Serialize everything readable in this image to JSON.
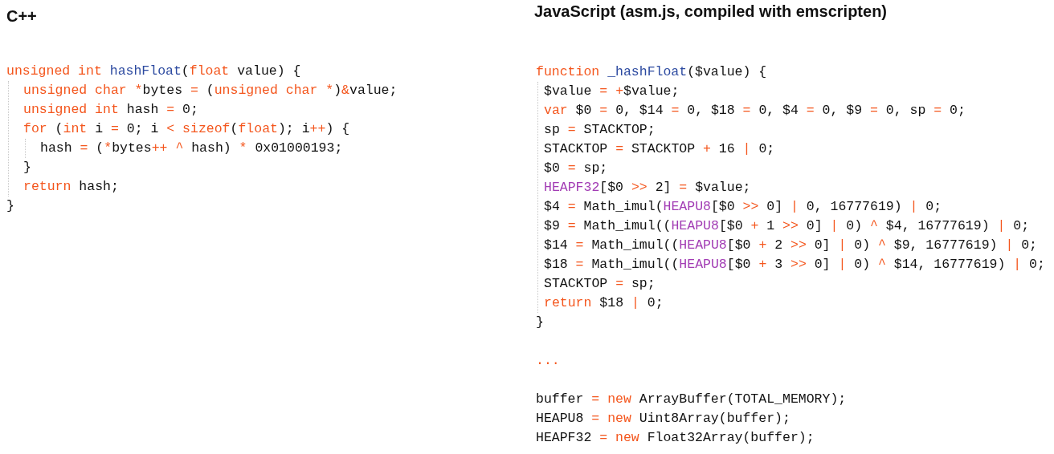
{
  "panels": [
    {
      "title": "C++",
      "blocks": [
        {
          "lines": [
            {
              "tokens": [
                {
                  "text": "unsigned int ",
                  "kind": "keyword"
                },
                {
                  "text": "hashFloat",
                  "kind": "function"
                },
                {
                  "text": "(",
                  "kind": "plain"
                },
                {
                  "text": "float",
                  "kind": "keyword"
                },
                {
                  "text": " value) {",
                  "kind": "plain"
                }
              ],
              "children": [
                {
                  "tokens": [
                    {
                      "text": "unsigned char *",
                      "kind": "keyword"
                    },
                    {
                      "text": "bytes ",
                      "kind": "plain"
                    },
                    {
                      "text": "=",
                      "kind": "keyword"
                    },
                    {
                      "text": " (",
                      "kind": "plain"
                    },
                    {
                      "text": "unsigned char *",
                      "kind": "keyword"
                    },
                    {
                      "text": ")",
                      "kind": "plain"
                    },
                    {
                      "text": "&",
                      "kind": "keyword"
                    },
                    {
                      "text": "value;",
                      "kind": "plain"
                    }
                  ]
                },
                {
                  "tokens": [
                    {
                      "text": "unsigned int",
                      "kind": "keyword"
                    },
                    {
                      "text": " hash ",
                      "kind": "plain"
                    },
                    {
                      "text": "=",
                      "kind": "keyword"
                    },
                    {
                      "text": " 0;",
                      "kind": "plain"
                    }
                  ]
                },
                {
                  "tokens": [
                    {
                      "text": "for",
                      "kind": "keyword"
                    },
                    {
                      "text": " (",
                      "kind": "plain"
                    },
                    {
                      "text": "int",
                      "kind": "keyword"
                    },
                    {
                      "text": " i ",
                      "kind": "plain"
                    },
                    {
                      "text": "=",
                      "kind": "keyword"
                    },
                    {
                      "text": " 0; i ",
                      "kind": "plain"
                    },
                    {
                      "text": "< ",
                      "kind": "keyword"
                    },
                    {
                      "text": "sizeof",
                      "kind": "keyword"
                    },
                    {
                      "text": "(",
                      "kind": "plain"
                    },
                    {
                      "text": "float",
                      "kind": "keyword"
                    },
                    {
                      "text": "); i",
                      "kind": "plain"
                    },
                    {
                      "text": "++",
                      "kind": "keyword"
                    },
                    {
                      "text": ") {",
                      "kind": "plain"
                    }
                  ],
                  "children": [
                    {
                      "tokens": [
                        {
                          "text": "hash ",
                          "kind": "plain"
                        },
                        {
                          "text": "=",
                          "kind": "keyword"
                        },
                        {
                          "text": " (",
                          "kind": "plain"
                        },
                        {
                          "text": "*",
                          "kind": "keyword"
                        },
                        {
                          "text": "bytes",
                          "kind": "plain"
                        },
                        {
                          "text": "++ ",
                          "kind": "keyword"
                        },
                        {
                          "text": "^",
                          "kind": "keyword"
                        },
                        {
                          "text": " hash) ",
                          "kind": "plain"
                        },
                        {
                          "text": "*",
                          "kind": "keyword"
                        },
                        {
                          "text": " 0x01000193;",
                          "kind": "plain"
                        }
                      ]
                    }
                  ]
                },
                {
                  "tokens": [
                    {
                      "text": "}",
                      "kind": "plain"
                    }
                  ]
                },
                {
                  "tokens": [
                    {
                      "text": "return",
                      "kind": "keyword"
                    },
                    {
                      "text": " hash;",
                      "kind": "plain"
                    }
                  ]
                }
              ]
            },
            {
              "tokens": [
                {
                  "text": "}",
                  "kind": "plain"
                }
              ]
            }
          ]
        }
      ]
    },
    {
      "title": "JavaScript (asm.js, compiled with emscripten)",
      "blocks": [
        {
          "lines": [
            {
              "tokens": [
                {
                  "text": "function ",
                  "kind": "keyword"
                },
                {
                  "text": "_hashFloat",
                  "kind": "function"
                },
                {
                  "text": "($value) {",
                  "kind": "plain"
                }
              ],
              "children": [
                {
                  "tokens": [
                    {
                      "text": "$value ",
                      "kind": "plain"
                    },
                    {
                      "text": "= ",
                      "kind": "keyword"
                    },
                    {
                      "text": "+",
                      "kind": "keyword"
                    },
                    {
                      "text": "$value;",
                      "kind": "plain"
                    }
                  ]
                },
                {
                  "tokens": [
                    {
                      "text": "var",
                      "kind": "keyword"
                    },
                    {
                      "text": " $0 ",
                      "kind": "plain"
                    },
                    {
                      "text": "=",
                      "kind": "keyword"
                    },
                    {
                      "text": " 0, $14 ",
                      "kind": "plain"
                    },
                    {
                      "text": "=",
                      "kind": "keyword"
                    },
                    {
                      "text": " 0, $18 ",
                      "kind": "plain"
                    },
                    {
                      "text": "=",
                      "kind": "keyword"
                    },
                    {
                      "text": " 0, $4 ",
                      "kind": "plain"
                    },
                    {
                      "text": "=",
                      "kind": "keyword"
                    },
                    {
                      "text": " 0, $9 ",
                      "kind": "plain"
                    },
                    {
                      "text": "=",
                      "kind": "keyword"
                    },
                    {
                      "text": " 0, sp ",
                      "kind": "plain"
                    },
                    {
                      "text": "=",
                      "kind": "keyword"
                    },
                    {
                      "text": " 0;",
                      "kind": "plain"
                    }
                  ]
                },
                {
                  "tokens": [
                    {
                      "text": "sp ",
                      "kind": "plain"
                    },
                    {
                      "text": "=",
                      "kind": "keyword"
                    },
                    {
                      "text": " STACKTOP;",
                      "kind": "plain"
                    }
                  ]
                },
                {
                  "tokens": [
                    {
                      "text": "STACKTOP ",
                      "kind": "plain"
                    },
                    {
                      "text": "=",
                      "kind": "keyword"
                    },
                    {
                      "text": " STACKTOP ",
                      "kind": "plain"
                    },
                    {
                      "text": "+",
                      "kind": "keyword"
                    },
                    {
                      "text": " 16 ",
                      "kind": "plain"
                    },
                    {
                      "text": "|",
                      "kind": "keyword"
                    },
                    {
                      "text": " 0;",
                      "kind": "plain"
                    }
                  ]
                },
                {
                  "tokens": [
                    {
                      "text": "$0 ",
                      "kind": "plain"
                    },
                    {
                      "text": "=",
                      "kind": "keyword"
                    },
                    {
                      "text": " sp;",
                      "kind": "plain"
                    }
                  ]
                },
                {
                  "tokens": [
                    {
                      "text": "HEAPF32",
                      "kind": "builtin"
                    },
                    {
                      "text": "[$0 ",
                      "kind": "plain"
                    },
                    {
                      "text": ">>",
                      "kind": "keyword"
                    },
                    {
                      "text": " 2] ",
                      "kind": "plain"
                    },
                    {
                      "text": "=",
                      "kind": "keyword"
                    },
                    {
                      "text": " $value;",
                      "kind": "plain"
                    }
                  ]
                },
                {
                  "tokens": [
                    {
                      "text": "$4 ",
                      "kind": "plain"
                    },
                    {
                      "text": "=",
                      "kind": "keyword"
                    },
                    {
                      "text": " Math_imul(",
                      "kind": "plain"
                    },
                    {
                      "text": "HEAPU8",
                      "kind": "builtin"
                    },
                    {
                      "text": "[$0 ",
                      "kind": "plain"
                    },
                    {
                      "text": ">>",
                      "kind": "keyword"
                    },
                    {
                      "text": " 0] ",
                      "kind": "plain"
                    },
                    {
                      "text": "|",
                      "kind": "keyword"
                    },
                    {
                      "text": " 0, 16777619) ",
                      "kind": "plain"
                    },
                    {
                      "text": "|",
                      "kind": "keyword"
                    },
                    {
                      "text": " 0;",
                      "kind": "plain"
                    }
                  ]
                },
                {
                  "tokens": [
                    {
                      "text": "$9 ",
                      "kind": "plain"
                    },
                    {
                      "text": "=",
                      "kind": "keyword"
                    },
                    {
                      "text": " Math_imul((",
                      "kind": "plain"
                    },
                    {
                      "text": "HEAPU8",
                      "kind": "builtin"
                    },
                    {
                      "text": "[$0 ",
                      "kind": "plain"
                    },
                    {
                      "text": "+",
                      "kind": "keyword"
                    },
                    {
                      "text": " 1 ",
                      "kind": "plain"
                    },
                    {
                      "text": ">>",
                      "kind": "keyword"
                    },
                    {
                      "text": " 0] ",
                      "kind": "plain"
                    },
                    {
                      "text": "|",
                      "kind": "keyword"
                    },
                    {
                      "text": " 0) ",
                      "kind": "plain"
                    },
                    {
                      "text": "^",
                      "kind": "keyword"
                    },
                    {
                      "text": " $4, 16777619) ",
                      "kind": "plain"
                    },
                    {
                      "text": "|",
                      "kind": "keyword"
                    },
                    {
                      "text": " 0;",
                      "kind": "plain"
                    }
                  ]
                },
                {
                  "tokens": [
                    {
                      "text": "$14 ",
                      "kind": "plain"
                    },
                    {
                      "text": "=",
                      "kind": "keyword"
                    },
                    {
                      "text": " Math_imul((",
                      "kind": "plain"
                    },
                    {
                      "text": "HEAPU8",
                      "kind": "builtin"
                    },
                    {
                      "text": "[$0 ",
                      "kind": "plain"
                    },
                    {
                      "text": "+",
                      "kind": "keyword"
                    },
                    {
                      "text": " 2 ",
                      "kind": "plain"
                    },
                    {
                      "text": ">>",
                      "kind": "keyword"
                    },
                    {
                      "text": " 0] ",
                      "kind": "plain"
                    },
                    {
                      "text": "|",
                      "kind": "keyword"
                    },
                    {
                      "text": " 0) ",
                      "kind": "plain"
                    },
                    {
                      "text": "^",
                      "kind": "keyword"
                    },
                    {
                      "text": " $9, 16777619) ",
                      "kind": "plain"
                    },
                    {
                      "text": "|",
                      "kind": "keyword"
                    },
                    {
                      "text": " 0;",
                      "kind": "plain"
                    }
                  ]
                },
                {
                  "tokens": [
                    {
                      "text": "$18 ",
                      "kind": "plain"
                    },
                    {
                      "text": "=",
                      "kind": "keyword"
                    },
                    {
                      "text": " Math_imul((",
                      "kind": "plain"
                    },
                    {
                      "text": "HEAPU8",
                      "kind": "builtin"
                    },
                    {
                      "text": "[$0 ",
                      "kind": "plain"
                    },
                    {
                      "text": "+",
                      "kind": "keyword"
                    },
                    {
                      "text": " 3 ",
                      "kind": "plain"
                    },
                    {
                      "text": ">>",
                      "kind": "keyword"
                    },
                    {
                      "text": " 0] ",
                      "kind": "plain"
                    },
                    {
                      "text": "|",
                      "kind": "keyword"
                    },
                    {
                      "text": " 0) ",
                      "kind": "plain"
                    },
                    {
                      "text": "^",
                      "kind": "keyword"
                    },
                    {
                      "text": " $14, 16777619) ",
                      "kind": "plain"
                    },
                    {
                      "text": "|",
                      "kind": "keyword"
                    },
                    {
                      "text": " 0;",
                      "kind": "plain"
                    }
                  ]
                },
                {
                  "tokens": [
                    {
                      "text": "STACKTOP ",
                      "kind": "plain"
                    },
                    {
                      "text": "=",
                      "kind": "keyword"
                    },
                    {
                      "text": " sp;",
                      "kind": "plain"
                    }
                  ]
                },
                {
                  "tokens": [
                    {
                      "text": "return",
                      "kind": "keyword"
                    },
                    {
                      "text": " $18 ",
                      "kind": "plain"
                    },
                    {
                      "text": "|",
                      "kind": "keyword"
                    },
                    {
                      "text": " 0;",
                      "kind": "plain"
                    }
                  ]
                }
              ]
            },
            {
              "tokens": [
                {
                  "text": "}",
                  "kind": "plain"
                }
              ]
            }
          ]
        },
        {
          "lines": [
            {
              "tokens": [
                {
                  "text": "...",
                  "kind": "keyword"
                }
              ]
            }
          ]
        },
        {
          "lines": [
            {
              "tokens": [
                {
                  "text": "buffer ",
                  "kind": "plain"
                },
                {
                  "text": "= ",
                  "kind": "keyword"
                },
                {
                  "text": "new",
                  "kind": "keyword"
                },
                {
                  "text": " ArrayBuffer(TOTAL_MEMORY);",
                  "kind": "plain"
                }
              ]
            },
            {
              "tokens": [
                {
                  "text": "HEAPU8 ",
                  "kind": "plain"
                },
                {
                  "text": "= ",
                  "kind": "keyword"
                },
                {
                  "text": "new",
                  "kind": "keyword"
                },
                {
                  "text": " Uint8Array(buffer);",
                  "kind": "plain"
                }
              ]
            },
            {
              "tokens": [
                {
                  "text": "HEAPF32 ",
                  "kind": "plain"
                },
                {
                  "text": "= ",
                  "kind": "keyword"
                },
                {
                  "text": "new",
                  "kind": "keyword"
                },
                {
                  "text": " Float32Array(buffer);",
                  "kind": "plain"
                }
              ]
            }
          ]
        }
      ]
    }
  ]
}
